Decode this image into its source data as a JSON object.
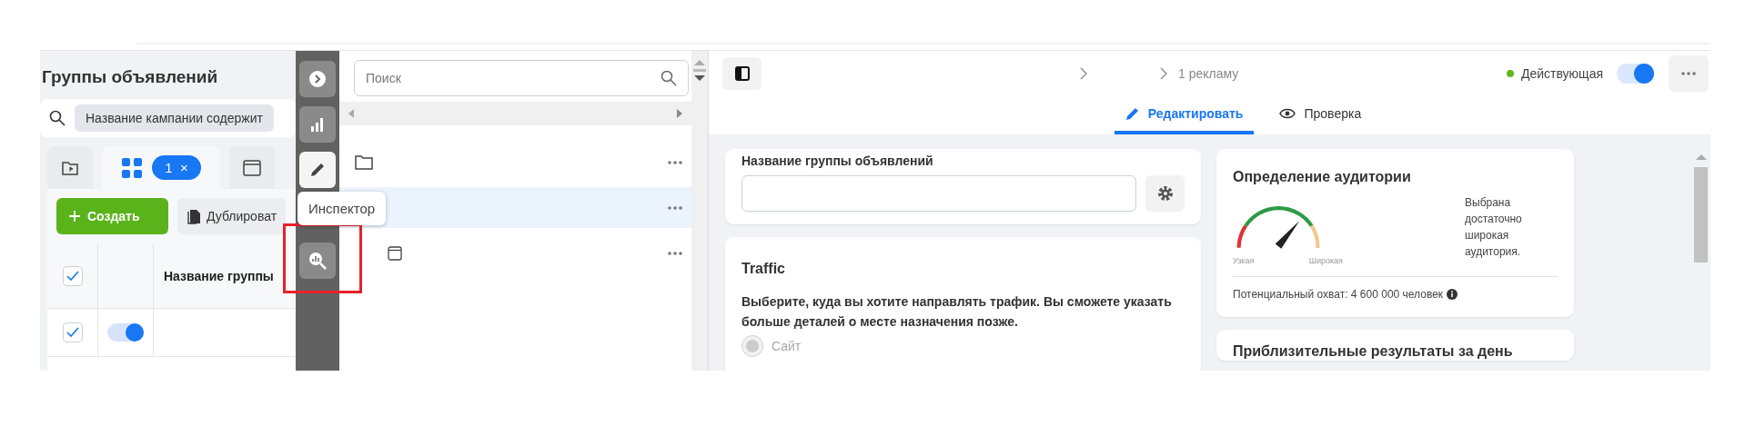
{
  "ad_sets_panel": {
    "title": "Группы объявлений",
    "filter": "Название кампании содержит",
    "tabs": [
      {
        "kind": "campaigns",
        "selected": false
      },
      {
        "kind": "ad-sets",
        "selected": true,
        "count": "1",
        "clear": "×"
      },
      {
        "kind": "ads",
        "selected": false
      }
    ],
    "create_button": "Создать",
    "duplicate_button": "Дублироват",
    "table": {
      "header": {
        "checked": true,
        "column": "Название группы"
      },
      "rows": [
        {
          "checked": true,
          "on": true
        }
      ]
    }
  },
  "tool_strip": {
    "items": [
      {
        "kind": "arrow",
        "selected": false
      },
      {
        "kind": "chart",
        "selected": false
      },
      {
        "kind": "pencil",
        "selected": true
      },
      {
        "kind": "inspect",
        "selected": false
      }
    ],
    "tooltip": "Инспектор"
  },
  "tree_panel": {
    "search": {
      "placeholder": "Поиск"
    },
    "items": [
      {
        "kind": "campaign",
        "selected": false
      },
      {
        "kind": "ad-set",
        "selected": true
      },
      {
        "kind": "ad",
        "selected": false
      }
    ]
  },
  "editor": {
    "breadcrumb": [
      "1 рекламу"
    ],
    "status": {
      "label": "Действующая",
      "color": "#63b51d",
      "on": true
    },
    "tabs": [
      {
        "kind": "edit",
        "label": "Редактировать",
        "selected": true
      },
      {
        "kind": "review",
        "label": "Проверка",
        "selected": false
      }
    ],
    "name_card": {
      "label": "Название группы объявлений"
    },
    "traffic_card": {
      "title": "Traffic",
      "description": "Выберите, куда вы хотите направлять трафик. Вы сможете указать больше деталей о месте назначения позже.",
      "options": [
        {
          "label": "Сайт",
          "selected": true,
          "disabled": true
        }
      ]
    },
    "audience_card": {
      "title": "Определение аудитории",
      "level": 0.72,
      "low_label": "Узкая",
      "high_label": "Широкая",
      "note": "Выбрана достаточно широкая аудитория.",
      "reach": "Потенциальный охват: 4 600 000 человек"
    },
    "results_card": {
      "title": "Приблизительные результаты за день"
    }
  }
}
